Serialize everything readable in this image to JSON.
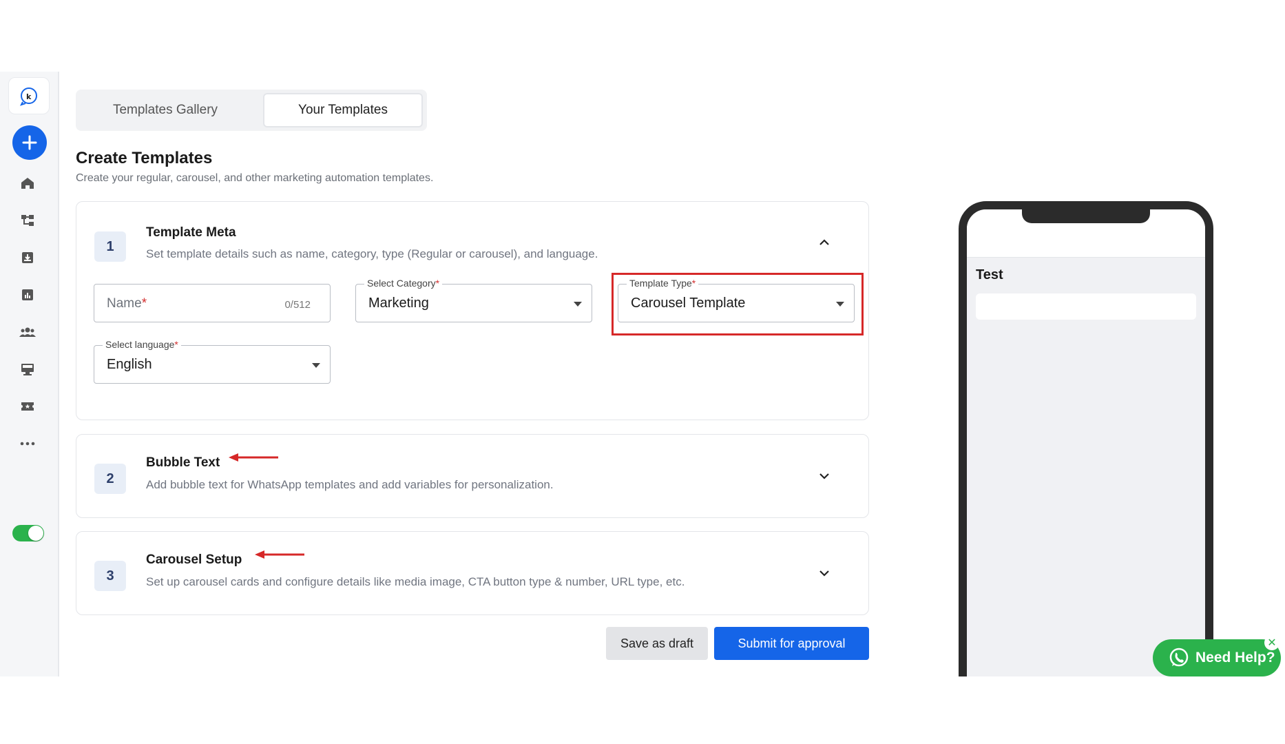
{
  "tabs": [
    {
      "label": "Templates Gallery"
    },
    {
      "label": "Your Templates"
    }
  ],
  "header": {
    "title": "Create Templates",
    "subtitle": "Create your regular, carousel, and other marketing automation templates."
  },
  "sections": [
    {
      "number": "1",
      "title": "Template Meta",
      "subtitle": "Set template details such as name, category, type (Regular or carousel), and language."
    },
    {
      "number": "2",
      "title": "Bubble Text",
      "subtitle": "Add bubble text for WhatsApp templates and add variables for personalization."
    },
    {
      "number": "3",
      "title": "Carousel Setup",
      "subtitle": "Set up carousel cards and configure details like media image, CTA button type & number, URL type, etc."
    }
  ],
  "form": {
    "name": {
      "placeholder": "Name",
      "required": "*",
      "count": "0/512"
    },
    "category": {
      "label": "Select Category",
      "required": "*",
      "value": "Marketing"
    },
    "template_type": {
      "label": "Template Type",
      "required": "*",
      "value": "Carousel Template"
    },
    "language": {
      "label": "Select language",
      "required": "*",
      "value": "English"
    }
  },
  "actions": {
    "draft": "Save as draft",
    "submit": "Submit for approval"
  },
  "preview": {
    "name": "Test"
  },
  "help": {
    "label": "Need Help?",
    "close": "✕"
  },
  "colors": {
    "primary": "#1565e8",
    "highlight": "#d62828",
    "whatsapp": "#2bb24c"
  },
  "icons": [
    "logo-icon",
    "plus-icon",
    "home-icon",
    "flow-icon",
    "inbox-icon",
    "analytics-icon",
    "contacts-icon",
    "campaign-icon",
    "ticket-icon",
    "more-icon"
  ]
}
